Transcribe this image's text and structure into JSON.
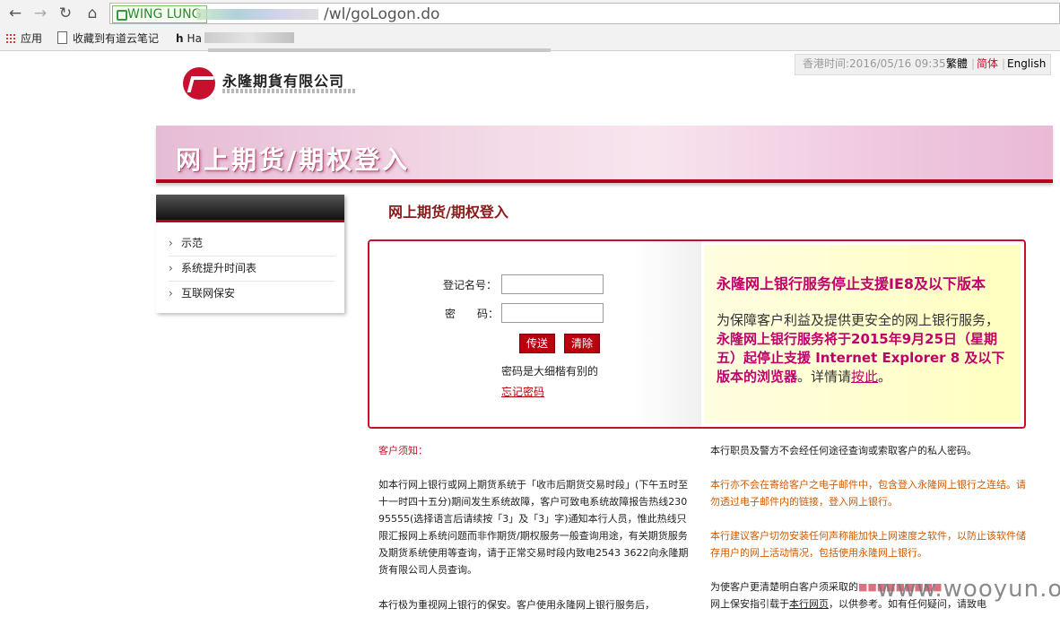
{
  "browser": {
    "ev_label": "WING LUNG",
    "url_tail": "/wl/goLogon.do",
    "bookmarks": [
      "应用",
      "收藏到有道云笔记",
      "Ha"
    ]
  },
  "header": {
    "logo_text": "永隆期貨有限公司",
    "time_label": "香港时间:2016/05/16 09:35",
    "lang": {
      "trad": "繁體",
      "simp": "简体",
      "en": "English"
    },
    "banner_title": "网上期货/期权登入"
  },
  "sidebar": {
    "items": [
      {
        "label": "示范"
      },
      {
        "label": "系统提升时间表"
      },
      {
        "label": "互联网保安"
      }
    ]
  },
  "main": {
    "title": "网上期货/期权登入",
    "login": {
      "username_label": "登记名号：",
      "password_label": "密　　码：",
      "username_value": "",
      "password_value": "",
      "submit": "传送",
      "clear": "清除",
      "case_note": "密码是大细楷有别的",
      "forgot": "忘记密码"
    },
    "notice": {
      "title": "永隆网上银行服务停止支援IE8及以下版本",
      "b1": "为保障客户利益及提供更安全的网上银行服务，",
      "b2": "永隆网上银行服务将于2015年9月25日（星期五）起停止支援 Internet Explorer 8 及以下版本的浏览器",
      "b3": "。详情请",
      "link": "按此",
      "b4": "。"
    }
  },
  "info": {
    "left_title": "客户须知：",
    "left_p1": "如本行网上银行或网上期货系统于「收市后期货交易时段」(下午五时至十一时四十五分)期间发生系统故障，客户可致电系统故障报告热线230 95555(选择语言后请续按「3」及「3」字)通知本行人员，惟此热线只限汇报网上系统问题而非作期货/期权服务一般查询用途，有关期货服务及期货系统使用等查询，请于正常交易时段内致电2543 3622向永隆期货有限公司人员查询。",
    "left_p2": "本行极为重视网上银行的保安。客户使用永隆网上银行服务后，",
    "right_p1": "本行职员及警方不会经任何途径查询或索取客户的私人密码。",
    "right_p2": "本行亦不会在寄给客户之电子邮件中，包含登入永隆网上银行之连结。请勿透过电子邮件内的链接，登入网上银行。",
    "right_p3": "本行建议客户切勿安装任何声称能加快上网速度之软件，以防止该软件储存用户的网上活动情况，包括使用永隆网上银行。",
    "right_p4a": "为使客户更清楚明白客户须采取的",
    "right_p4b": "网上保安指引载于",
    "right_p4link": "本行网页",
    "right_p4c": "，以供参考。如有任何疑问，请致电"
  },
  "watermark": "www.wooyun.org"
}
